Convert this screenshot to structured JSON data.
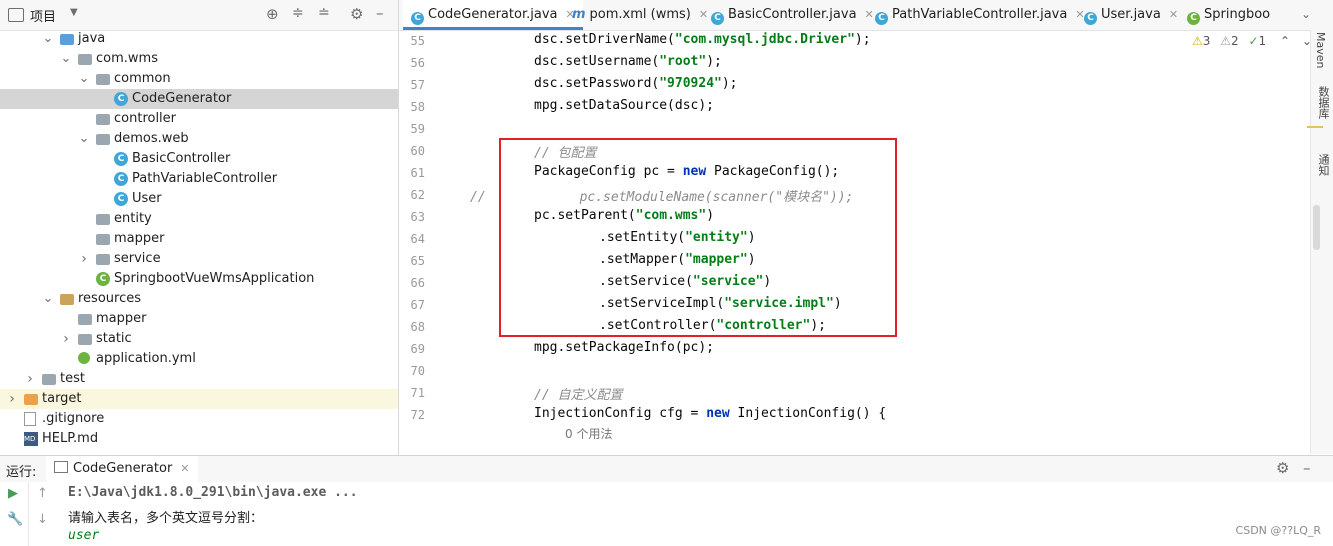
{
  "project_panel": {
    "title": "项目",
    "tree": [
      {
        "label": "java",
        "kind": "folder-blue",
        "expanded": true
      },
      {
        "label": "com.wms",
        "kind": "package",
        "expanded": true
      },
      {
        "label": "common",
        "kind": "package",
        "expanded": true
      },
      {
        "label": "CodeGenerator",
        "kind": "class-run",
        "selected": true
      },
      {
        "label": "controller",
        "kind": "package"
      },
      {
        "label": "demos.web",
        "kind": "package",
        "expanded": true
      },
      {
        "label": "BasicController",
        "kind": "class"
      },
      {
        "label": "PathVariableController",
        "kind": "class"
      },
      {
        "label": "User",
        "kind": "class"
      },
      {
        "label": "entity",
        "kind": "package"
      },
      {
        "label": "mapper",
        "kind": "package"
      },
      {
        "label": "service",
        "kind": "package",
        "collapsed": true
      },
      {
        "label": "SpringbootVueWmsApplication",
        "kind": "spring-class"
      },
      {
        "label": "resources",
        "kind": "folder-res",
        "expanded": true
      },
      {
        "label": "mapper",
        "kind": "folder"
      },
      {
        "label": "static",
        "kind": "folder",
        "collapsed": true
      },
      {
        "label": "application.yml",
        "kind": "yml"
      },
      {
        "label": "test",
        "kind": "folder",
        "collapsed": true
      },
      {
        "label": "target",
        "kind": "folder-orange",
        "collapsed": true
      },
      {
        "label": ".gitignore",
        "kind": "file"
      },
      {
        "label": "HELP.md",
        "kind": "md"
      }
    ]
  },
  "tabs": [
    {
      "label": "CodeGenerator.java",
      "icon": "class-icon",
      "active": true
    },
    {
      "label": "pom.xml (wms)",
      "icon": "maven-icon"
    },
    {
      "label": "BasicController.java",
      "icon": "class-icon"
    },
    {
      "label": "PathVariableController.java",
      "icon": "class-icon"
    },
    {
      "label": "User.java",
      "icon": "class-icon"
    },
    {
      "label": "Springboo",
      "icon": "spring-icon"
    }
  ],
  "inspections": {
    "warnings": "3",
    "weak": "2",
    "typos": "1"
  },
  "editor": {
    "lines": [
      {
        "n": "55",
        "code": "dsc.setDriverName(\"com.mysql.jdbc.Driver\");"
      },
      {
        "n": "56",
        "code": "dsc.setUsername(\"root\");"
      },
      {
        "n": "57",
        "code": "dsc.setPassword(\"970924\");"
      },
      {
        "n": "58",
        "code": "mpg.setDataSource(dsc);"
      },
      {
        "n": "59",
        "code": ""
      },
      {
        "n": "60",
        "code": "// 包配置"
      },
      {
        "n": "61",
        "code": "PackageConfig pc = new PackageConfig();"
      },
      {
        "n": "62",
        "code": "//            pc.setModuleName(scanner(\"模块名\"));"
      },
      {
        "n": "63",
        "code": "pc.setParent(\"com.wms\")"
      },
      {
        "n": "64",
        "code": ".setEntity(\"entity\")"
      },
      {
        "n": "65",
        "code": ".setMapper(\"mapper\")"
      },
      {
        "n": "66",
        "code": ".setService(\"service\")"
      },
      {
        "n": "67",
        "code": ".setServiceImpl(\"service.impl\")"
      },
      {
        "n": "68",
        "code": ".setController(\"controller\");"
      },
      {
        "n": "69",
        "code": "mpg.setPackageInfo(pc);"
      },
      {
        "n": "70",
        "code": ""
      },
      {
        "n": "71",
        "code": "// 自定义配置"
      },
      {
        "n": "72",
        "code": "InjectionConfig cfg = new InjectionConfig() {"
      }
    ],
    "usage_hint": "0 个用法"
  },
  "right_sidebar": {
    "maven": "Maven",
    "database": "数据库",
    "notifications": "通知"
  },
  "run_panel": {
    "label": "运行:",
    "tab": "CodeGenerator",
    "output": [
      "E:\\Java\\jdk1.8.0_291\\bin\\java.exe ...",
      "请输入表名，多个英文逗号分割：",
      "user"
    ],
    "watermark": "CSDN @??LQ_R"
  },
  "colors": {
    "accent": "#4083c9",
    "highlight_box": "#e0202a",
    "string": "#067d17",
    "keyword": "#0033b3"
  }
}
